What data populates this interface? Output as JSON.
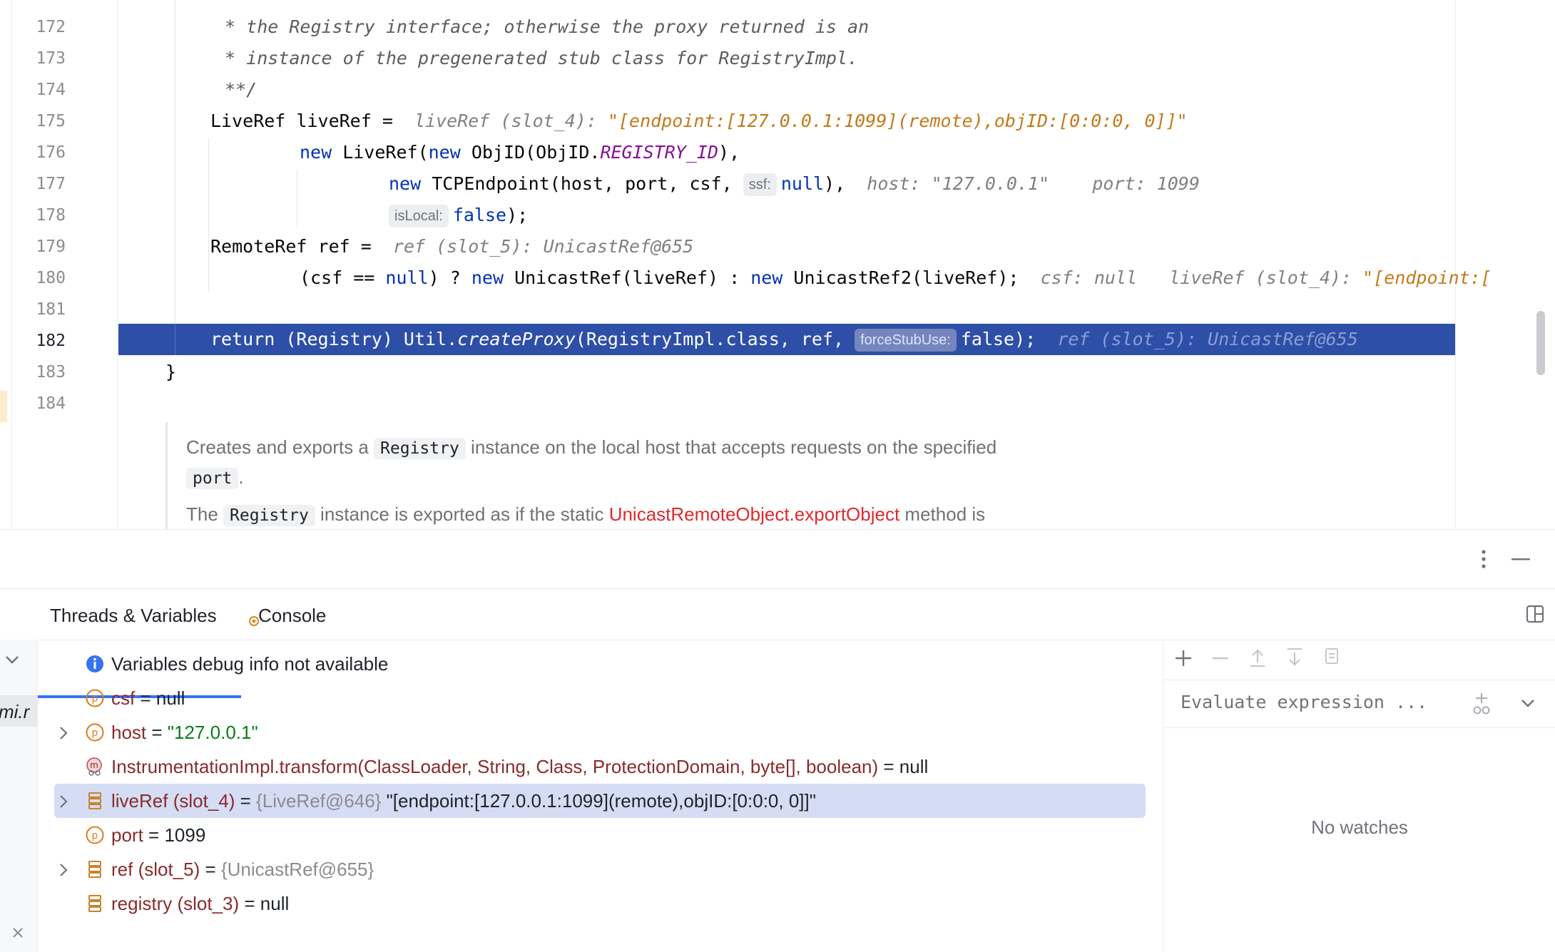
{
  "editor": {
    "line_numbers": [
      "172",
      "173",
      "174",
      "175",
      "176",
      "177",
      "178",
      "179",
      "180",
      "181",
      "182",
      "183",
      "184"
    ],
    "current_line": "182",
    "lines": {
      "l172": " * the Registry interface; otherwise the proxy returned is an",
      "l173": " * instance of the pregenerated stub class for RegistryImpl.",
      "l174": " **/",
      "l175_code": "LiveRef liveRef = ",
      "l175_hint_name": "liveRef (slot_4): ",
      "l175_hint_val": "\"[endpoint:[127.0.0.1:1099](remote),objID:[0:0:0, 0]]\"",
      "l176_kw1": "new",
      "l176_a": " LiveRef(",
      "l176_kw2": "new",
      "l176_b": " ObjID(ObjID.",
      "l176_field": "REGISTRY_ID",
      "l176_c": "),",
      "l177_kw": "new",
      "l177_a": " TCPEndpoint(host, port, csf, ",
      "l177_pill": "ssf:",
      "l177_null": "null",
      "l177_b": "),",
      "l177_hint1": "host: \"127.0.0.1\"",
      "l177_hint2": "port: 1099",
      "l178_pill": "isLocal:",
      "l178_false": "false",
      "l178_end": ");",
      "l179_code": "RemoteRef ref = ",
      "l179_hint": "ref (slot_5): UnicastRef@655",
      "l180_a": "(csf == ",
      "l180_null": "null",
      "l180_b": ") ? ",
      "l180_new1": "new",
      "l180_c": " UnicastRef(liveRef) : ",
      "l180_new2": "new",
      "l180_d": " UnicastRef2(liveRef);",
      "l180_hint1": "csf: null",
      "l180_hint2_name": "liveRef (slot_4): ",
      "l180_hint2_val": "\"[endpoint:[",
      "l182_a": "return (Registry) Util.",
      "l182_method": "createProxy",
      "l182_b": "(RegistryImpl.class, ref, ",
      "l182_pill": "forceStubUse:",
      "l182_c": "false);",
      "l182_hint": "ref (slot_5): UnicastRef@655",
      "l183": "}"
    },
    "doc": {
      "p1_a": "Creates and exports a ",
      "p1_chip1": "Registry",
      "p1_b": " instance on the local host that accepts requests on the specified",
      "p1_chip2": "port",
      "p1_c": ".",
      "p2_a": "The ",
      "p2_chip": "Registry",
      "p2_b": " instance is exported as if the static ",
      "p2_link": "UnicastRemoteObject.exportObject",
      "p2_c": " method is"
    }
  },
  "debug": {
    "tabs": [
      {
        "label": "Threads & Variables",
        "active": true
      },
      {
        "label": "Console",
        "active": false
      }
    ],
    "frame_fragment": "mi.r",
    "variables": [
      {
        "icon": "info",
        "text": "Variables debug info not available"
      },
      {
        "icon": "param",
        "name": "csf",
        "eq": " = ",
        "value": "null"
      },
      {
        "icon": "param",
        "name": "host",
        "eq": " = ",
        "value": "\"127.0.0.1\"",
        "expandable": true
      },
      {
        "icon": "method",
        "name": "InstrumentationImpl.transform(ClassLoader, String, Class, ProtectionDomain, byte[], boolean)",
        "eq": " = ",
        "value": "null"
      },
      {
        "icon": "local",
        "name": "liveRef (slot_4)",
        "eq": " = ",
        "ref": "{LiveRef@646}",
        "value": " \"[endpoint:[127.0.0.1:1099](remote),objID:[0:0:0, 0]]\"",
        "expandable": true,
        "selected": true
      },
      {
        "icon": "param",
        "name": "port",
        "eq": " = ",
        "value": "1099"
      },
      {
        "icon": "local",
        "name": "ref (slot_5)",
        "eq": " = ",
        "ref": "{UnicastRef@655}",
        "expandable": true
      },
      {
        "icon": "local",
        "name": "registry (slot_3)",
        "eq": " = ",
        "value": "null"
      }
    ],
    "watches": {
      "eval_placeholder": "Evaluate expression ...",
      "empty_text": "No watches"
    }
  },
  "colors": {
    "accent": "#3574f0",
    "selection": "#2e4fa7",
    "keyword": "#0033b3"
  }
}
